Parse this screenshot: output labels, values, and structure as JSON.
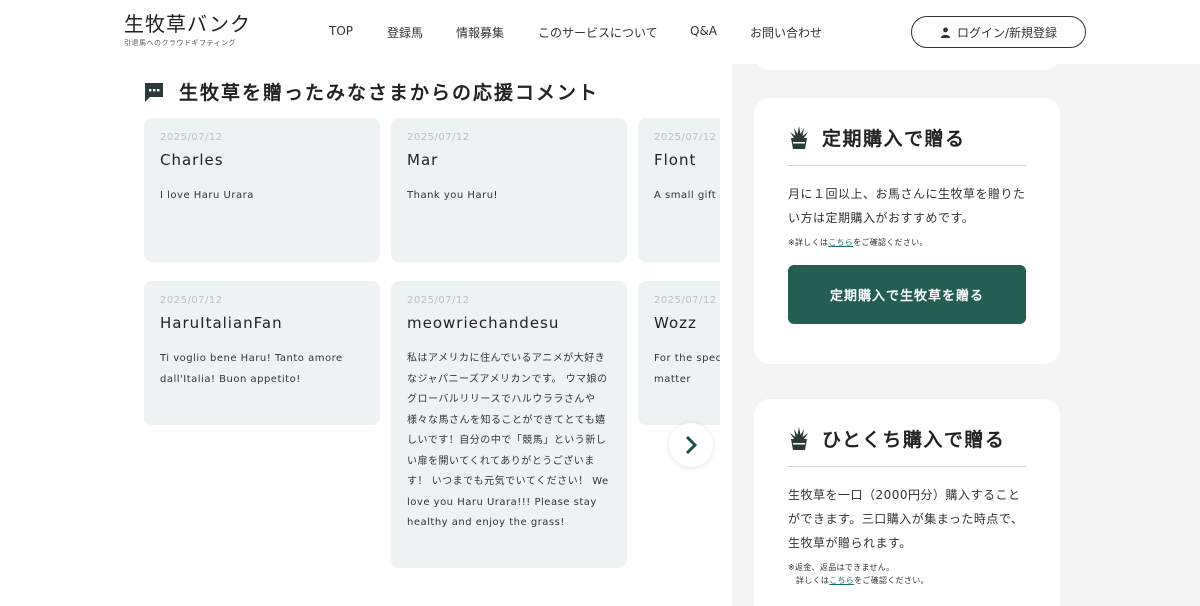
{
  "header": {
    "logo_main": "生牧草バンク",
    "logo_sub": "引退馬へのクラウドギフティング",
    "nav": [
      "TOP",
      "登録馬",
      "情報募集",
      "このサービスについて",
      "Q&A",
      "お問い合わせ"
    ],
    "login_label": "ログイン/新規登録"
  },
  "section": {
    "title": "生牧草を贈ったみなさまからの応援コメント",
    "icon": "comment-bubble-icon"
  },
  "comments": [
    {
      "date": "2025/07/12",
      "name": "Charles",
      "text": "I love Haru Urara"
    },
    {
      "date": "2025/07/12",
      "name": "Mar",
      "text": "Thank you Haru!"
    },
    {
      "date": "2025/07/12",
      "name": "Flont",
      "text": "A small gift horse"
    },
    {
      "date": "2025/07/12",
      "name": "HaruItalianFan",
      "text": "Ti voglio bene Haru! Tanto amore dall'Italia! Buon appetito!"
    },
    {
      "date": "2025/07/12",
      "name": "meowriechandesu",
      "text": "私はアメリカに住んでいるアニメが大好きなジャパニーズアメリカンです。 ウマ娘のグローバルリリースでハルウララさんや様々な馬さんを知ることができてとても嬉しいです！自分の中で「競馬」という新しい扉を開いてくれてありがとうございます！ いつまでも元気でいてください！ We love you Haru Urara!!! Please stay healthy and enjoy the grass!"
    },
    {
      "date": "2025/07/12",
      "name": "Wozz",
      "text": "For the spec up no matter"
    }
  ],
  "carousel": {
    "next_icon": "chevron-right-icon"
  },
  "subscription": {
    "title": "定期購入で贈る",
    "icon": "grass-bucket-icon",
    "desc": "月に１回以上、お馬さんに生牧草を贈りたい方は定期購入がおすすめです。",
    "note_prefix": "※詳しくは",
    "note_link": "こちら",
    "note_suffix": "をご確認ください。",
    "cta": "定期購入で生牧草を贈る"
  },
  "single": {
    "title": "ひとくち購入で贈る",
    "icon": "grass-bucket-icon",
    "desc": "生牧草を一口（2000円分）購入することができます。三口購入が集まった時点で、生牧草が贈られます。",
    "note_line1": "※返金、返品はできません。",
    "note_prefix": "詳しくは",
    "note_link": "こちら",
    "note_suffix": "をご確認ください。"
  },
  "colors": {
    "brand_green": "#245e52",
    "card_bg": "#eef2f3",
    "link": "#1f6b6a"
  }
}
